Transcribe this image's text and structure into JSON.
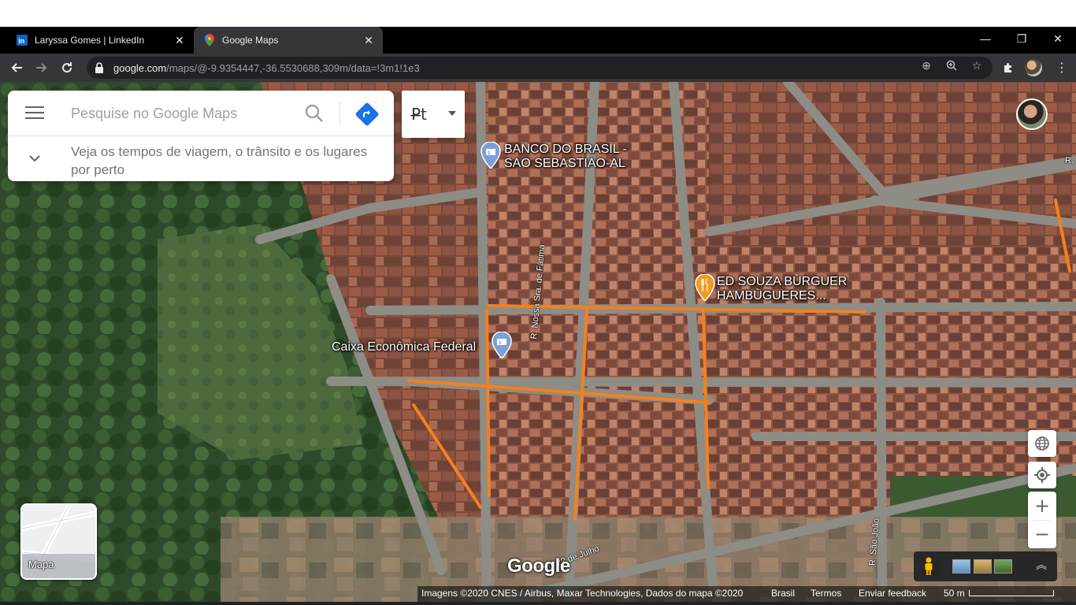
{
  "browser": {
    "tabs": [
      {
        "title": "Laryssa Gomes | LinkedIn",
        "active": false,
        "icon": "linkedin-icon"
      },
      {
        "title": "Google Maps",
        "active": true,
        "icon": "google-maps-icon"
      }
    ],
    "url_host": "google.com",
    "url_path": "/maps/@-9.9354447,-36.5530688,309m/data=!3m1!1e3"
  },
  "search": {
    "placeholder": "Pesquise no Google Maps",
    "expand_text": "Veja os tempos de viagem, o trânsito e os lugares por perto"
  },
  "input_tools": {
    "label": "P̶t"
  },
  "places": [
    {
      "name": "BANCO DO BRASIL - SAO SEBASTIAO-AL",
      "line1": "BANCO DO BRASIL -",
      "line2": "SAO SEBASTIAO-AL",
      "type": "bank"
    },
    {
      "name": "ED SOUZA BÙRGUER HAMBÙGUERES...",
      "line1": "ED SOUZA BÙRGUER",
      "line2": "HAMBÙGUERES...",
      "type": "restaurant"
    },
    {
      "name": "Caixa Econômica Federal",
      "line1": "Caixa Econômica Federal",
      "type": "bank"
    }
  ],
  "streets": {
    "nossa_sra": "R. Nossa Sra. de Fátima",
    "julho": "22 de Julho",
    "sao_joao": "R. São João",
    "edge": "R."
  },
  "layer_switch": {
    "label": "Mapa"
  },
  "logo": "Google",
  "attribution": {
    "imagery": "Imagens ©2020 CNES / Airbus, Maxar Technologies, Dados do mapa ©2020",
    "country": "Brasil",
    "terms": "Termos",
    "feedback": "Enviar feedback",
    "scale": "50 m"
  },
  "colors": {
    "annotation_orange": "#f5801e",
    "chrome_dark": "#35363a",
    "tab_bar": "#000000"
  }
}
